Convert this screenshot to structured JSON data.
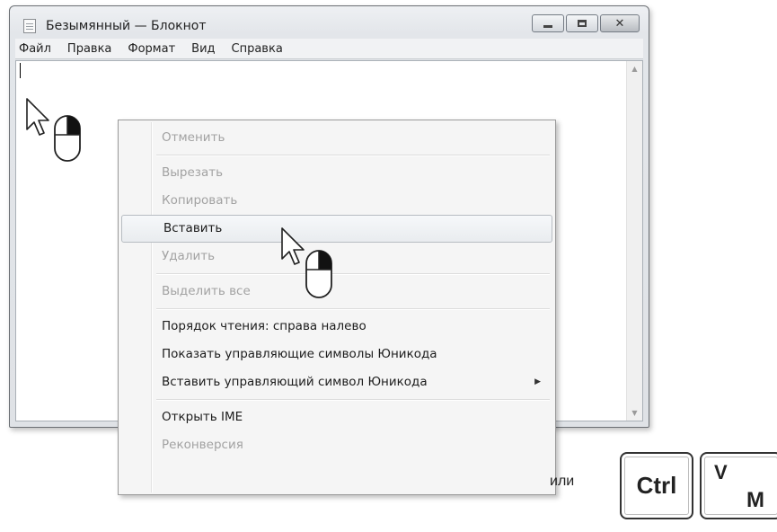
{
  "window": {
    "title": "Безымянный — Блокнот",
    "menu": [
      "Файл",
      "Правка",
      "Формат",
      "Вид",
      "Справка"
    ]
  },
  "context_menu": {
    "items": [
      {
        "label": "Отменить",
        "state": "disabled"
      },
      {
        "separator": true
      },
      {
        "label": "Вырезать",
        "state": "disabled"
      },
      {
        "label": "Копировать",
        "state": "disabled"
      },
      {
        "label": "Вставить",
        "state": "highlighted"
      },
      {
        "label": "Удалить",
        "state": "disabled"
      },
      {
        "separator": true
      },
      {
        "label": "Выделить все",
        "state": "disabled"
      },
      {
        "separator": true
      },
      {
        "label": "Порядок чтения: справа налево",
        "state": "enabled"
      },
      {
        "label": "Показать управляющие символы Юникода",
        "state": "enabled"
      },
      {
        "label": "Вставить управляющий символ Юникода",
        "state": "enabled",
        "submenu": true
      },
      {
        "separator": true
      },
      {
        "label": "Открыть IME",
        "state": "enabled"
      },
      {
        "label": "Реконверсия",
        "state": "disabled"
      }
    ]
  },
  "shortcut": {
    "or_text": "или",
    "key_ctrl": "Ctrl",
    "key_v_latin": "V",
    "key_v_cyrillic": "М"
  },
  "icons": {
    "minimize": "minimize-icon",
    "maximize": "maximize-icon",
    "close": "close-icon",
    "submenu": "submenu-arrow-icon",
    "cursor": "mouse-pointer-icon",
    "mouse_right_click": "mouse-right-click-icon"
  }
}
